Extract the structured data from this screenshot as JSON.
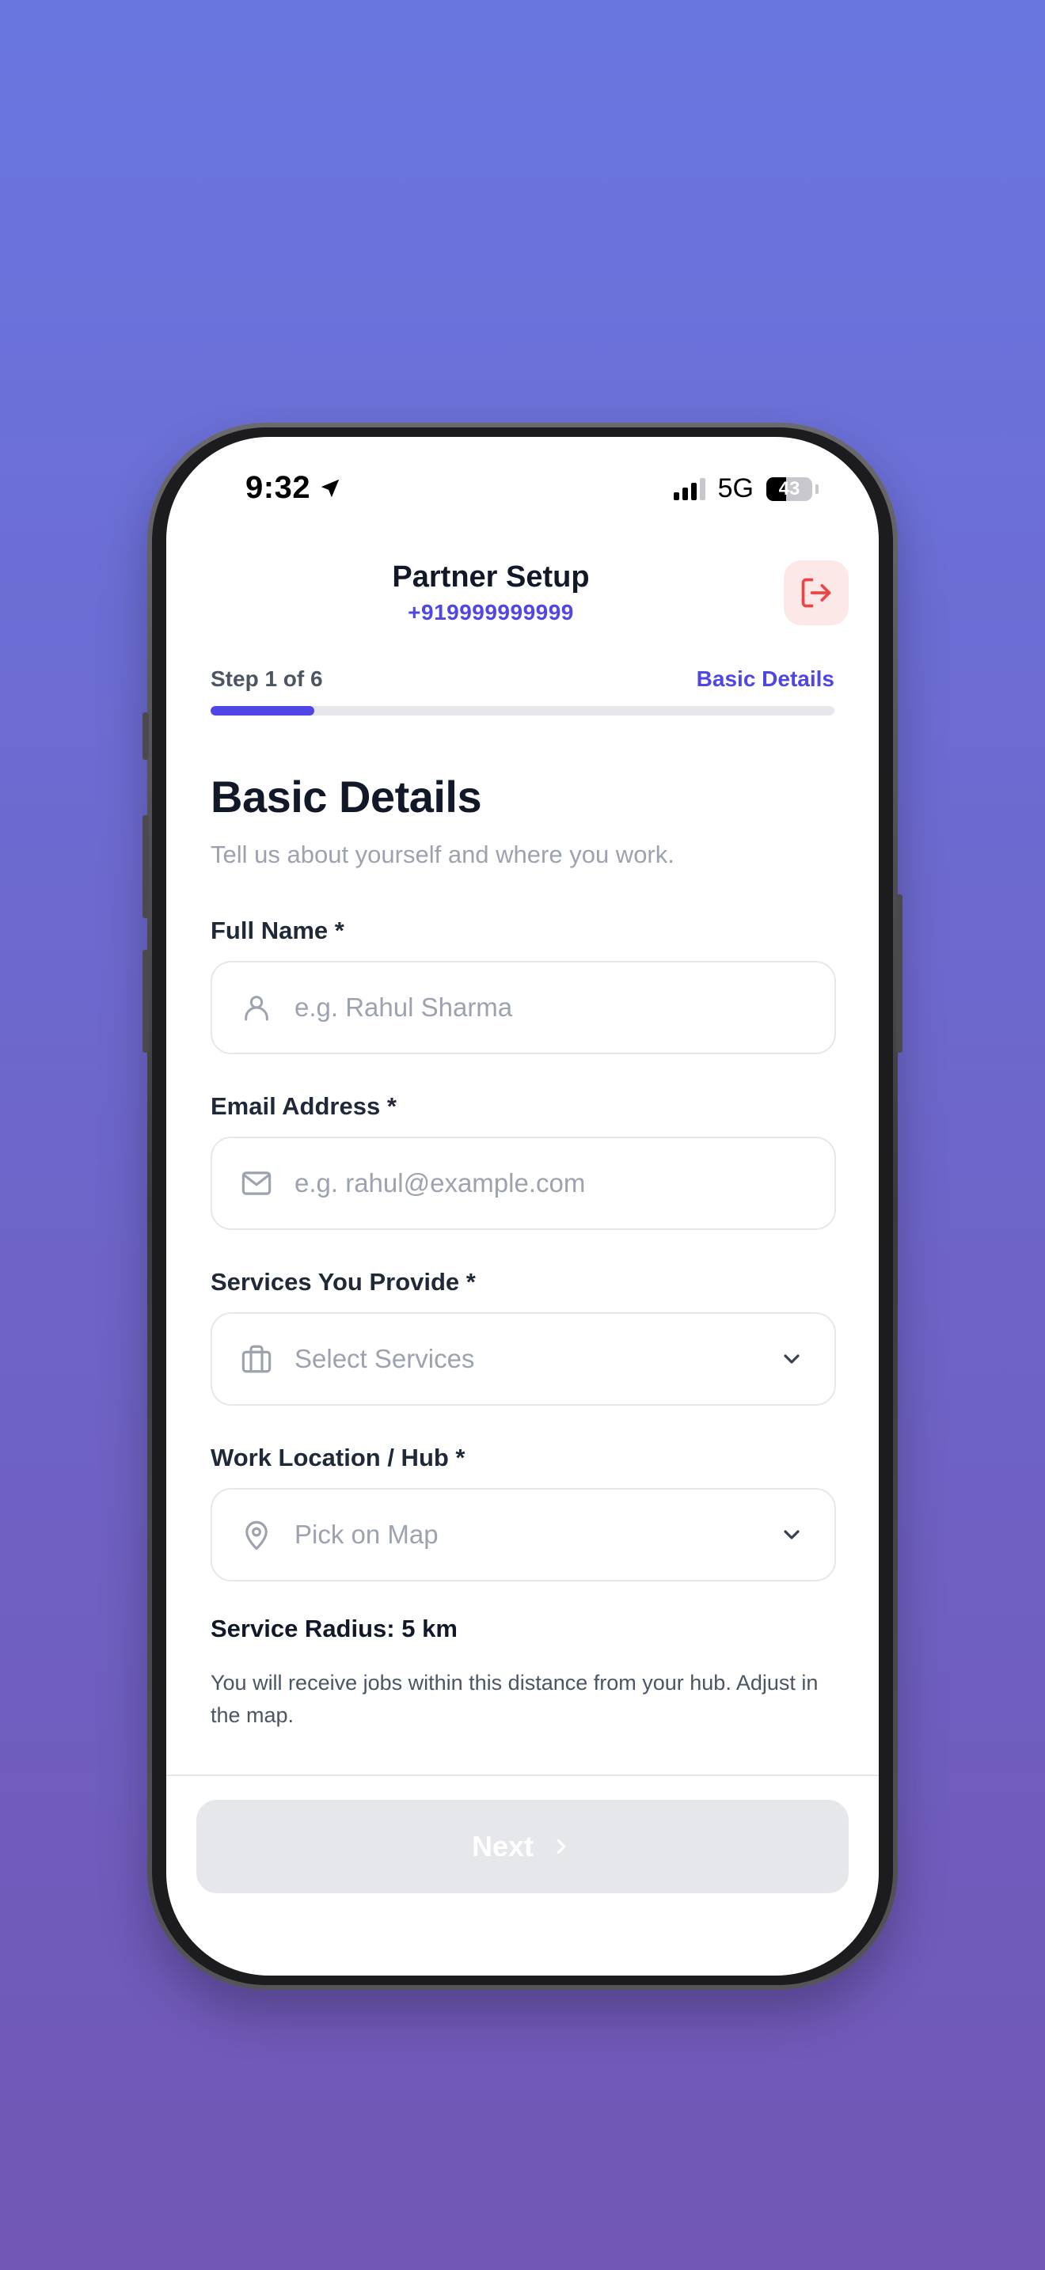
{
  "status_bar": {
    "time": "9:32",
    "network": "5G",
    "battery": "43"
  },
  "header": {
    "title": "Partner Setup",
    "phone": "+919999999999"
  },
  "progress": {
    "step_label": "Step 1 of 6",
    "step_name": "Basic Details",
    "fraction": 0.1667
  },
  "page": {
    "title": "Basic Details",
    "subtitle": "Tell us about yourself and where you work."
  },
  "fields": {
    "full_name": {
      "label": "Full Name *",
      "placeholder": "e.g. Rahul Sharma"
    },
    "email": {
      "label": "Email Address *",
      "placeholder": "e.g. rahul@example.com"
    },
    "services": {
      "label": "Services You Provide *",
      "placeholder": "Select Services"
    },
    "location": {
      "label": "Work Location / Hub *",
      "placeholder": "Pick on Map"
    }
  },
  "service_radius": {
    "title": "Service Radius: 5 km",
    "description": "You will receive jobs within this distance from your hub. Adjust in the map."
  },
  "footer": {
    "next_label": "Next"
  },
  "colors": {
    "accent": "#4f46e5",
    "danger": "#ef4444",
    "background_top": "#6a76e0",
    "background_bottom": "#7156b4"
  }
}
